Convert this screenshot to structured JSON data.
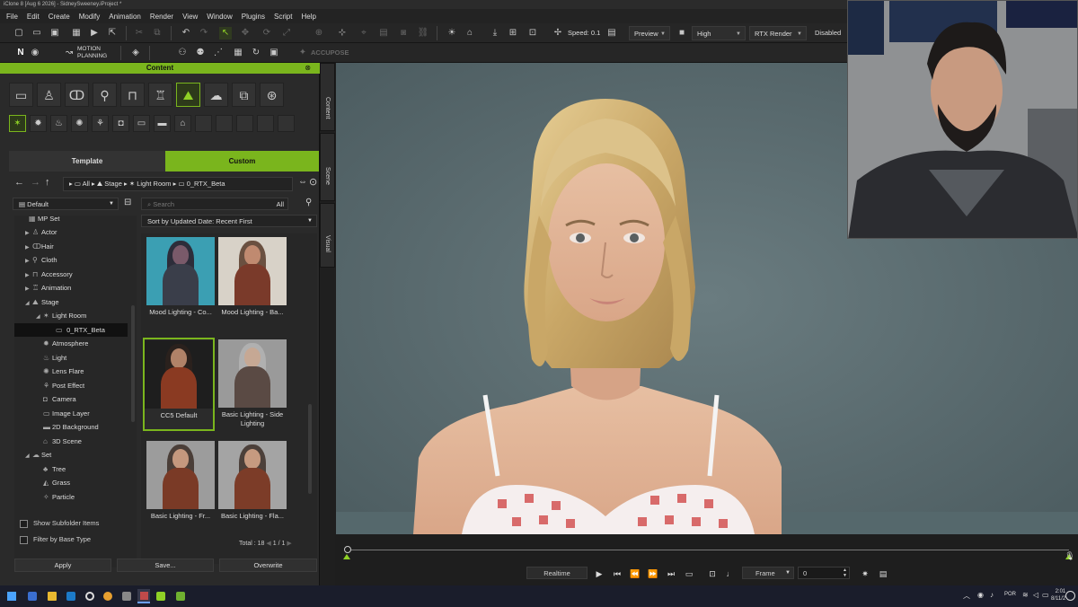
{
  "window": {
    "title": "iClone 8 [Aug  6 2026] - SidneySweeney.iProject *"
  },
  "menu": [
    "File",
    "Edit",
    "Create",
    "Modify",
    "Animation",
    "Render",
    "View",
    "Window",
    "Plugins",
    "Script",
    "Help"
  ],
  "toolbar": {
    "speed": "Speed: 0.1",
    "preview": "Preview",
    "quality": "High",
    "render_mode": "RTX Render",
    "rtx_state": "Disabled",
    "motion_planning_line1": "MOTION",
    "motion_planning_line2": "PLANNING",
    "accupose": "ACCUPOSE"
  },
  "content_panel": {
    "title": "Content",
    "tabs": [
      "Template",
      "Custom"
    ],
    "active_tab": "Custom",
    "breadcrumb": [
      "All",
      "Stage",
      "Light Room",
      "0_RTX_Beta"
    ],
    "folder_dropdown": "Default",
    "search_placeholder": "Search",
    "search_scope": "All",
    "sort": "Sort by Updated Date: Recent First",
    "tree": [
      {
        "label": "MP Set",
        "indent": 1
      },
      {
        "label": "Actor",
        "indent": 1
      },
      {
        "label": "Hair",
        "indent": 1
      },
      {
        "label": "Cloth",
        "indent": 1
      },
      {
        "label": "Accessory",
        "indent": 1
      },
      {
        "label": "Animation",
        "indent": 1
      },
      {
        "label": "Stage",
        "indent": 1
      },
      {
        "label": "Light Room",
        "indent": 2
      },
      {
        "label": "0_RTX_Beta",
        "indent": 3,
        "selected": true
      },
      {
        "label": "Atmosphere",
        "indent": 2
      },
      {
        "label": "Light",
        "indent": 2
      },
      {
        "label": "Lens Flare",
        "indent": 2
      },
      {
        "label": "Post Effect",
        "indent": 2
      },
      {
        "label": "Camera",
        "indent": 2
      },
      {
        "label": "Image Layer",
        "indent": 2
      },
      {
        "label": "2D Background",
        "indent": 2
      },
      {
        "label": "3D Scene",
        "indent": 2
      },
      {
        "label": "Set",
        "indent": 1
      },
      {
        "label": "Tree",
        "indent": 2
      },
      {
        "label": "Grass",
        "indent": 2
      },
      {
        "label": "Particle",
        "indent": 2
      }
    ],
    "items": [
      {
        "caption": "Mood Lighting - Co...",
        "bg": "#3b9fb3",
        "hair": "#2d2d3a",
        "body": "#3a3e4a"
      },
      {
        "caption": "Mood Lighting - Ba...",
        "bg": "#d8d2c8",
        "hair": "#6a5040",
        "body": "#7a3a2a"
      },
      {
        "caption": "CC5 Default",
        "bg": "#1e1e1e",
        "hair": "#2a211d",
        "body": "#8a3a22",
        "selected": true
      },
      {
        "caption": "Basic Lighting - Side Lighting",
        "bg": "#9a9a9a",
        "hair": "#b0b0b0",
        "body": "#5a4a44"
      },
      {
        "caption": "Basic Lighting - Fr...",
        "bg": "#9c9c9c",
        "hair": "#4a3e38",
        "body": "#7a3a26"
      },
      {
        "caption": "Basic Lighting - Fla...",
        "bg": "#a4a4a4",
        "hair": "#4c403a",
        "body": "#7c3c28"
      }
    ],
    "total": "Total : 18",
    "page_current": "1",
    "page_sep": "/",
    "page_total": "1",
    "show_subfolder": "Show Subfolder Items",
    "filter_base": "Filter by Base Type",
    "apply": "Apply",
    "save": "Save...",
    "overwrite": "Overwrite"
  },
  "side_tabs": [
    "Content",
    "Scene",
    "Visual"
  ],
  "timeline": {
    "mode": "Realtime",
    "frame_label": "Frame",
    "frame_value": "0"
  },
  "taskbar": {
    "lang": "POR",
    "time": "2:01",
    "date": "8/11/2"
  }
}
